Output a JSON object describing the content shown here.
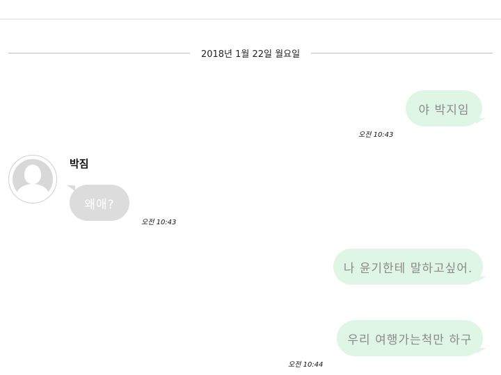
{
  "date_divider": "2018년 1월 22일 월요일",
  "messages": [
    {
      "text": "야 박지임",
      "time": "오전 10:43"
    },
    {
      "sender": "박짐",
      "text": "왜애?",
      "time": "오전 10:43"
    },
    {
      "text": "나 윤기한테 말하고싶어."
    },
    {
      "text": "우리 여행가는척만 하구",
      "time": "오전 10:44"
    }
  ],
  "colors": {
    "outgoing_bubble": "#dff5e6",
    "incoming_bubble": "#dcdcdc"
  },
  "icons": {
    "avatar": "default-profile-avatar-icon"
  }
}
